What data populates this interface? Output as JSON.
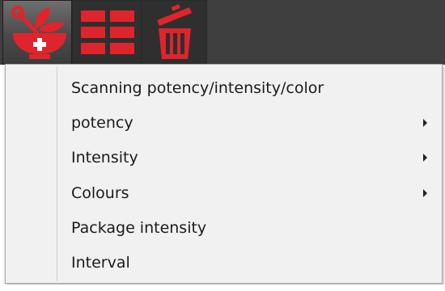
{
  "toolbar": {
    "buttons": [
      {
        "name": "herbal-mortar",
        "icon": "mortar-pestle-herb-icon",
        "active": true
      },
      {
        "name": "grid-layout",
        "icon": "grid-icon",
        "active": false
      },
      {
        "name": "delete",
        "icon": "trash-can-icon",
        "active": false
      }
    ],
    "icon_color": "#e0242b"
  },
  "menu": {
    "items": [
      {
        "label": "Scanning potency/intensity/color",
        "submenu": false
      },
      {
        "label": "potency",
        "submenu": true
      },
      {
        "label": "Intensity",
        "submenu": true
      },
      {
        "label": "Colours",
        "submenu": true
      },
      {
        "label": "Package intensity",
        "submenu": false
      },
      {
        "label": "Interval",
        "submenu": false
      }
    ]
  }
}
